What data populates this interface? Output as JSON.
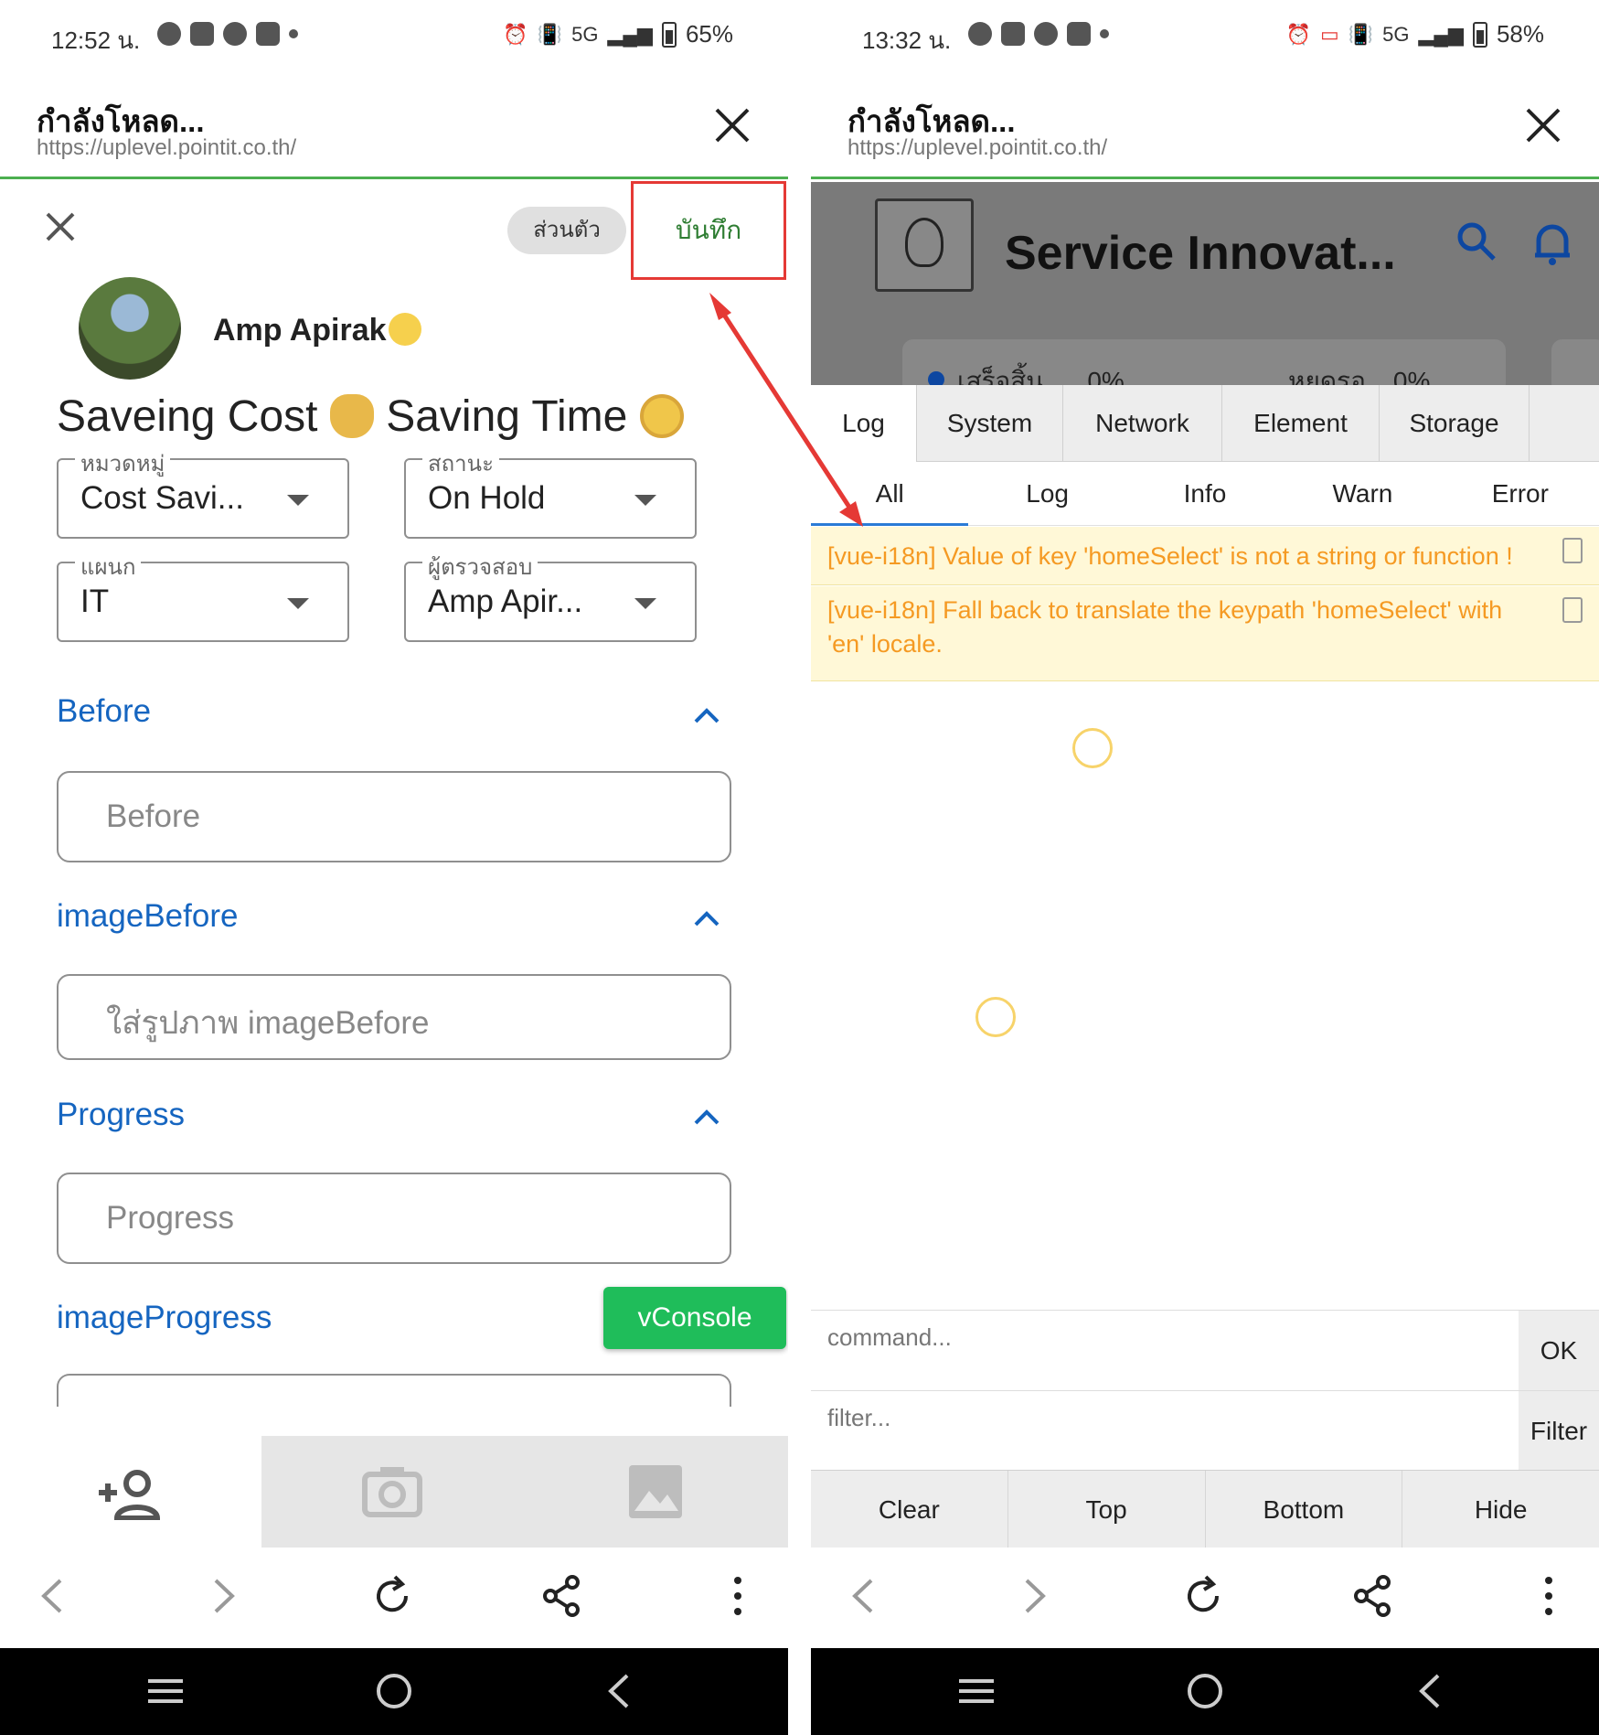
{
  "left": {
    "status": {
      "time": "12:52 น.",
      "network": "5G",
      "battery": "65%"
    },
    "browser": {
      "title": "กำลังโหลด...",
      "url": "https://uplevel.pointit.co.th/"
    },
    "dialog": {
      "visibility_chip": "ส่วนตัว",
      "save_label": "บันทึก",
      "user_name": "Amp Apirak",
      "heading_part1": "Saveing Cost",
      "heading_part2": "Saving Time",
      "fields": [
        {
          "label": "หมวดหมู่",
          "value": "Cost Savi..."
        },
        {
          "label": "สถานะ",
          "value": "On Hold"
        },
        {
          "label": "แผนก",
          "value": "IT"
        },
        {
          "label": "ผู้ตรวจสอบ",
          "value": "Amp Apir..."
        }
      ],
      "sections": [
        {
          "title": "Before",
          "placeholder": "Before"
        },
        {
          "title": "imageBefore",
          "placeholder": "ใส่รูปภาพ imageBefore"
        },
        {
          "title": "Progress",
          "placeholder": "Progress"
        },
        {
          "title": "imageProgress",
          "placeholder": ""
        }
      ],
      "vconsole_label": "vConsole"
    }
  },
  "right": {
    "status": {
      "time": "13:32 น.",
      "network": "5G",
      "battery": "58%"
    },
    "browser": {
      "title": "กำลังโหลด...",
      "url": "https://uplevel.pointit.co.th/"
    },
    "page": {
      "title": "Service Innovat...",
      "stats": [
        {
          "label": "เสร็จสิ้น",
          "value": "0%"
        },
        {
          "label": "หยุดรอ",
          "value": "0%"
        }
      ]
    },
    "vconsole": {
      "tabs": [
        "Log",
        "System",
        "Network",
        "Element",
        "Storage"
      ],
      "subtabs": [
        "All",
        "Log",
        "Info",
        "Warn",
        "Error"
      ],
      "active_subtab": "All",
      "logs": [
        "[vue-i18n] Value of key 'homeSelect' is not a string or function !",
        "[vue-i18n] Fall back to translate the keypath 'homeSelect' with 'en' locale."
      ],
      "command_placeholder": "command...",
      "ok_label": "OK",
      "filter_placeholder": "filter...",
      "filter_label": "Filter",
      "footer": [
        "Clear",
        "Top",
        "Bottom",
        "Hide"
      ]
    }
  },
  "colors": {
    "accent_green": "#4caf50",
    "save_text": "#2e7d32",
    "highlight_red": "#e53935",
    "section_blue": "#1565c0",
    "vconsole_green": "#1fbd5a",
    "warn_bg": "#fff8d7",
    "warn_text": "#f59a23"
  }
}
